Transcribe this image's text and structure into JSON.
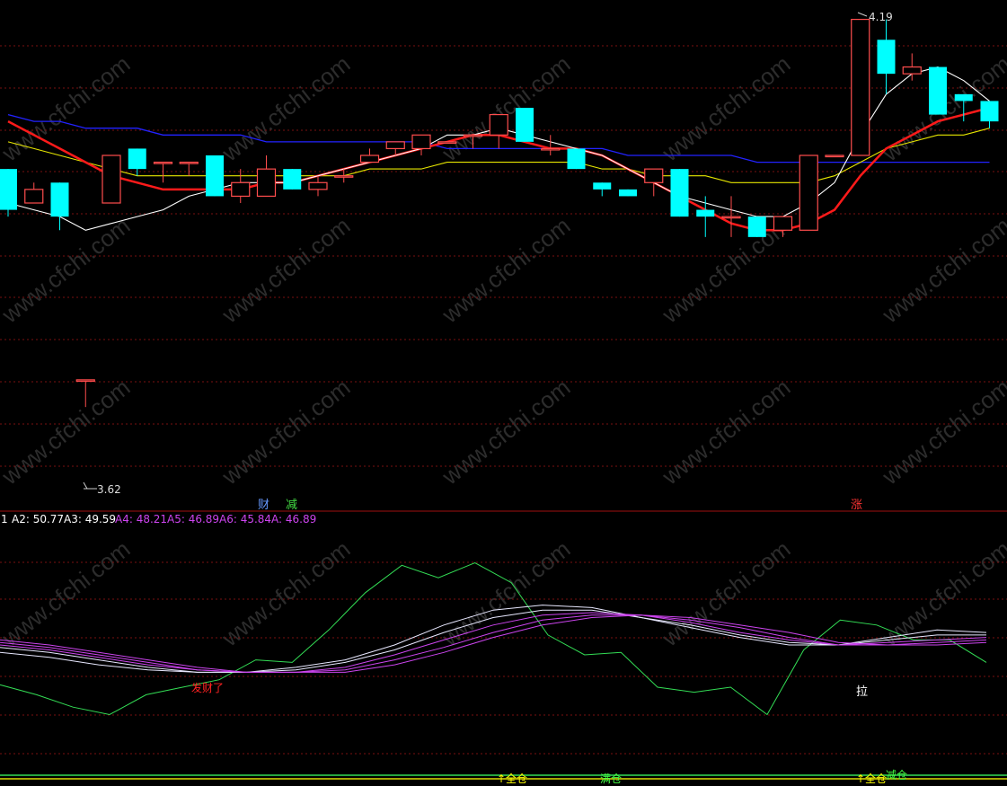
{
  "colors": {
    "background": "#000000",
    "grid": "#7a0f0f",
    "up_candle": "#ff4d4d",
    "down_candle": "#00ffff",
    "ma_white": "#ffffff",
    "ma_red": "#ff1a1a",
    "ma_yellow": "#e6e600",
    "ma_blue": "#2222ff",
    "osc_green": "#33dd55",
    "osc_pink": "#cc44ee",
    "osc_white": "#e8e8ff"
  },
  "watermark": "www.cfchi.com",
  "chart_data": [
    {
      "type": "candlestick",
      "ylim": [
        3.5,
        4.2
      ],
      "grid": true,
      "candles": [
        {
          "o": 3.97,
          "h": 3.97,
          "l": 3.9,
          "c": 3.91
        },
        {
          "o": 3.92,
          "h": 3.95,
          "l": 3.92,
          "c": 3.94
        },
        {
          "o": 3.95,
          "h": 3.95,
          "l": 3.88,
          "c": 3.9
        },
        {
          "o": 3.66,
          "h": 3.66,
          "l": 3.62,
          "c": 3.66
        },
        {
          "o": 3.92,
          "h": 3.95,
          "l": 3.92,
          "c": 3.99
        },
        {
          "o": 4.0,
          "h": 4.0,
          "l": 3.96,
          "c": 3.97
        },
        {
          "o": 3.98,
          "h": 3.98,
          "l": 3.95,
          "c": 3.98
        },
        {
          "o": 3.98,
          "h": 3.98,
          "l": 3.96,
          "c": 3.98
        },
        {
          "o": 3.99,
          "h": 3.99,
          "l": 3.95,
          "c": 3.93
        },
        {
          "o": 3.93,
          "h": 3.97,
          "l": 3.92,
          "c": 3.95
        },
        {
          "o": 3.93,
          "h": 3.99,
          "l": 3.93,
          "c": 3.97
        },
        {
          "o": 3.97,
          "h": 3.97,
          "l": 3.94,
          "c": 3.94
        },
        {
          "o": 3.94,
          "h": 3.96,
          "l": 3.93,
          "c": 3.95
        },
        {
          "o": 3.96,
          "h": 3.97,
          "l": 3.95,
          "c": 3.96
        },
        {
          "o": 3.98,
          "h": 4.0,
          "l": 3.98,
          "c": 3.99
        },
        {
          "o": 4.0,
          "h": 4.0,
          "l": 3.99,
          "c": 4.01
        },
        {
          "o": 4.0,
          "h": 4.02,
          "l": 3.99,
          "c": 4.02
        },
        {
          "o": 4.01,
          "h": 4.01,
          "l": 4.01,
          "c": 4.01
        },
        {
          "o": 4.02,
          "h": 4.02,
          "l": 4.0,
          "c": 4.02
        },
        {
          "o": 4.02,
          "h": 4.05,
          "l": 4.0,
          "c": 4.05
        },
        {
          "o": 4.06,
          "h": 4.05,
          "l": 4.01,
          "c": 4.01
        },
        {
          "o": 4.0,
          "h": 4.02,
          "l": 3.99,
          "c": 4.0
        },
        {
          "o": 4.0,
          "h": 4.0,
          "l": 3.98,
          "c": 3.97
        },
        {
          "o": 3.95,
          "h": 3.95,
          "l": 3.93,
          "c": 3.94
        },
        {
          "o": 3.94,
          "h": 3.94,
          "l": 3.93,
          "c": 3.93
        },
        {
          "o": 3.95,
          "h": 3.95,
          "l": 3.93,
          "c": 3.97
        },
        {
          "o": 3.97,
          "h": 3.97,
          "l": 3.9,
          "c": 3.9
        },
        {
          "o": 3.91,
          "h": 3.93,
          "l": 3.87,
          "c": 3.9
        },
        {
          "o": 3.9,
          "h": 3.93,
          "l": 3.87,
          "c": 3.9
        },
        {
          "o": 3.9,
          "h": 3.9,
          "l": 3.87,
          "c": 3.87
        },
        {
          "o": 3.88,
          "h": 3.89,
          "l": 3.87,
          "c": 3.9
        },
        {
          "o": 3.88,
          "h": 3.99,
          "l": 3.88,
          "c": 3.99
        },
        {
          "o": 3.99,
          "h": 3.99,
          "l": 3.99,
          "c": 3.99
        },
        {
          "o": 3.99,
          "h": 4.19,
          "l": 3.99,
          "c": 4.19
        },
        {
          "o": 4.16,
          "h": 4.19,
          "l": 4.08,
          "c": 4.11
        },
        {
          "o": 4.11,
          "h": 4.14,
          "l": 4.1,
          "c": 4.12
        },
        {
          "o": 4.12,
          "h": 4.12,
          "l": 4.05,
          "c": 4.05
        },
        {
          "o": 4.08,
          "h": 4.08,
          "l": 4.04,
          "c": 4.07
        },
        {
          "o": 4.07,
          "h": 4.07,
          "l": 4.03,
          "c": 4.04
        }
      ],
      "ma_white": [
        3.92,
        3.91,
        3.9,
        3.88,
        3.89,
        3.9,
        3.91,
        3.93,
        3.94,
        3.95,
        3.95,
        3.95,
        3.96,
        3.97,
        3.98,
        3.99,
        4.0,
        4.02,
        4.02,
        4.03,
        4.02,
        4.01,
        4.0,
        3.99,
        3.97,
        3.95,
        3.93,
        3.92,
        3.91,
        3.9,
        3.9,
        3.92,
        3.95,
        4.02,
        4.08,
        4.11,
        4.12,
        4.1,
        4.07
      ],
      "ma_red": [
        4.04,
        4.02,
        4.0,
        3.98,
        3.96,
        3.95,
        3.94,
        3.94,
        3.94,
        3.94,
        3.95,
        3.95,
        3.96,
        3.97,
        3.98,
        3.99,
        4.0,
        4.01,
        4.02,
        4.02,
        4.01,
        4.0,
        4.0,
        3.99,
        3.97,
        3.95,
        3.93,
        3.91,
        3.89,
        3.88,
        3.88,
        3.89,
        3.91,
        3.96,
        4.0,
        4.02,
        4.04,
        4.05,
        4.06
      ],
      "ma_yellow": [
        4.01,
        4.0,
        3.99,
        3.98,
        3.97,
        3.96,
        3.96,
        3.96,
        3.96,
        3.96,
        3.96,
        3.96,
        3.96,
        3.96,
        3.97,
        3.97,
        3.97,
        3.98,
        3.98,
        3.98,
        3.98,
        3.98,
        3.98,
        3.97,
        3.97,
        3.96,
        3.96,
        3.96,
        3.95,
        3.95,
        3.95,
        3.95,
        3.96,
        3.98,
        4.0,
        4.01,
        4.02,
        4.02,
        4.03
      ],
      "ma_blue": [
        4.05,
        4.04,
        4.04,
        4.03,
        4.03,
        4.03,
        4.02,
        4.02,
        4.02,
        4.02,
        4.01,
        4.01,
        4.01,
        4.01,
        4.01,
        4.01,
        4.01,
        4.0,
        4.0,
        4.0,
        4.0,
        4.0,
        4.0,
        4.0,
        3.99,
        3.99,
        3.99,
        3.99,
        3.99,
        3.98,
        3.98,
        3.98,
        3.98,
        3.98,
        3.98,
        3.98,
        3.98,
        3.98,
        3.98
      ],
      "annotations": [
        {
          "text": "3.62",
          "kind": "low-label"
        },
        {
          "text": "4.19",
          "kind": "high-label"
        }
      ],
      "markers": [
        {
          "text": "财",
          "color": "#6699ff"
        },
        {
          "text": "减",
          "color": "#44dd44"
        },
        {
          "text": "涨",
          "color": "#ff3333"
        }
      ]
    },
    {
      "type": "line",
      "ylim": [
        0,
        100
      ],
      "legend_prefix": "1",
      "legend": [
        {
          "label": "A2: 50.77",
          "color": "#ffffff"
        },
        {
          "label": "A3: 49.59",
          "color": "#ffffff"
        },
        {
          "label": "A4: 48.21",
          "color": "#cc44ee"
        },
        {
          "label": "A5: 46.89",
          "color": "#cc44ee"
        },
        {
          "label": "A6: 45.84",
          "color": "#cc44ee"
        },
        {
          "label": "A: 46.89",
          "color": "#cc44ee"
        }
      ],
      "series": [
        {
          "name": "",
          "color": "#33dd55",
          "values": [
            36,
            32,
            27,
            24,
            32,
            35,
            38,
            46,
            45,
            58,
            73,
            84,
            79,
            85,
            77,
            56,
            48,
            49,
            35,
            33,
            35,
            24,
            50,
            62,
            60,
            54,
            54,
            45
          ]
        },
        {
          "name": "A2",
          "color": "#e8e8ff",
          "values": [
            49,
            47,
            44,
            42,
            41,
            41,
            43,
            46,
            52,
            60,
            66,
            68,
            67,
            63,
            59,
            55,
            52,
            52,
            55,
            58,
            57
          ]
        },
        {
          "name": "A3",
          "color": "#e8e8ff",
          "values": [
            51,
            49,
            46,
            43,
            41,
            41,
            42,
            45,
            50,
            57,
            63,
            66,
            66,
            63,
            60,
            56,
            53,
            52,
            54,
            56,
            56
          ]
        },
        {
          "name": "A4",
          "color": "#cc44ee",
          "values": [
            52,
            50,
            47,
            44,
            42,
            41,
            41,
            43,
            48,
            54,
            60,
            64,
            65,
            64,
            61,
            57,
            54,
            52,
            53,
            54,
            55
          ]
        },
        {
          "name": "A5",
          "color": "#cc44ee",
          "values": [
            53,
            51,
            48,
            45,
            42,
            41,
            41,
            42,
            46,
            51,
            57,
            62,
            64,
            64,
            62,
            59,
            55,
            52,
            52,
            53,
            54
          ]
        },
        {
          "name": "A6",
          "color": "#cc44ee",
          "values": [
            54,
            52,
            49,
            46,
            43,
            41,
            41,
            41,
            44,
            49,
            55,
            60,
            63,
            64,
            63,
            60,
            57,
            53,
            52,
            52,
            53
          ]
        }
      ],
      "labels": [
        {
          "text": "发财了",
          "color": "#ff2222"
        },
        {
          "text": "拉",
          "color": "#ffffff"
        }
      ],
      "bottom_tags": [
        {
          "text": "↑全仓",
          "color": "#ffff00"
        },
        {
          "text": "满仓",
          "color": "#44ff44"
        },
        {
          "text": "↑全仓",
          "color": "#ffff00"
        },
        {
          "text": "减仓",
          "color": "#44ff44"
        }
      ]
    }
  ]
}
